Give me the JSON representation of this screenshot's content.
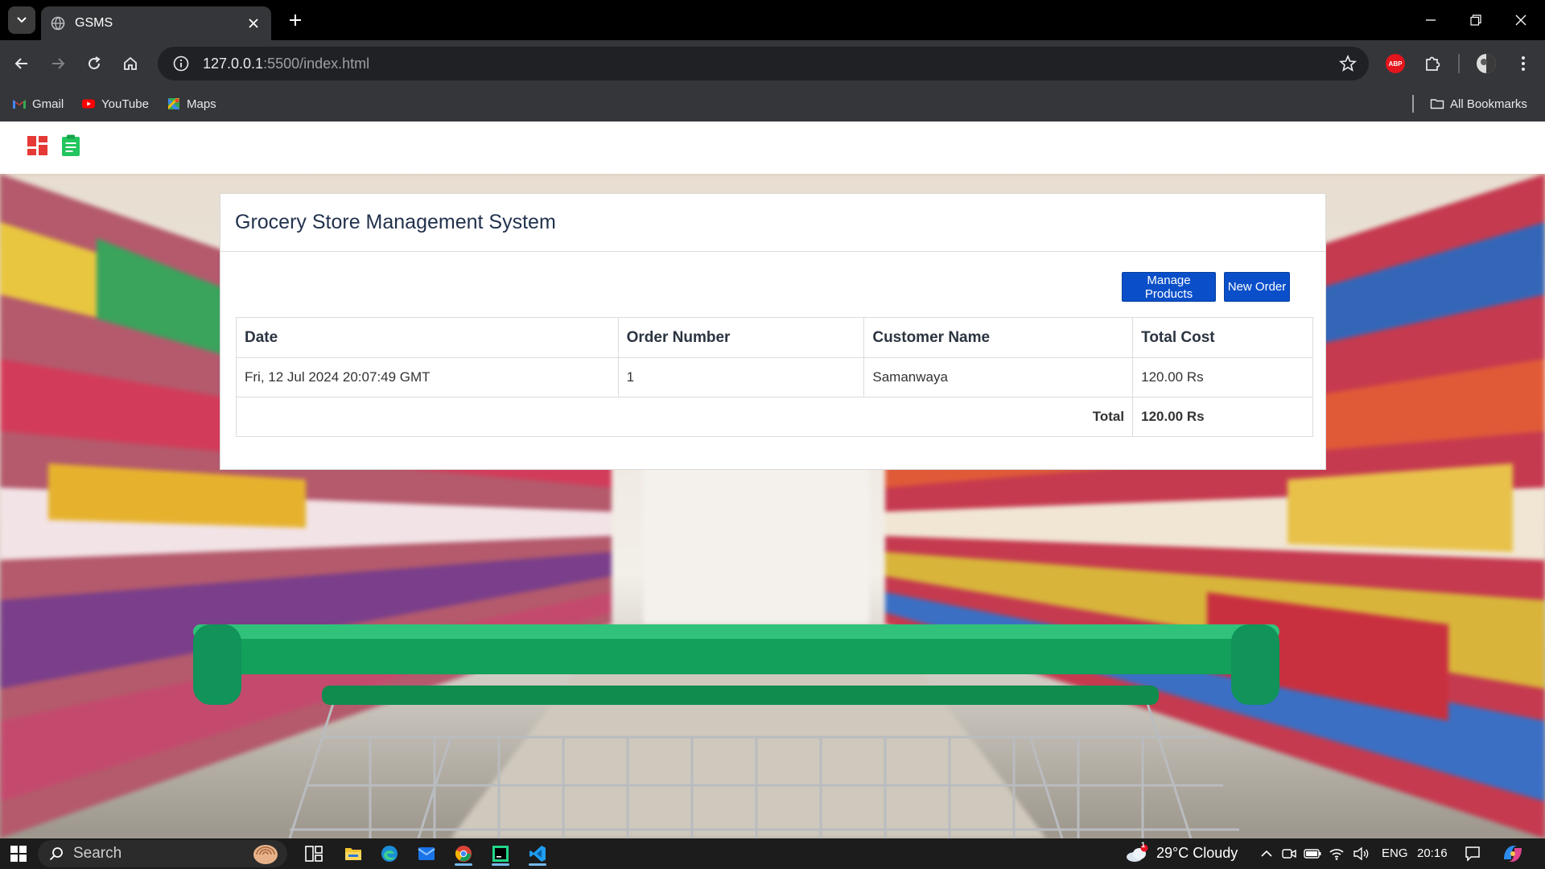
{
  "browser": {
    "tab_title": "GSMS",
    "url_host": "127.0.0.1",
    "url_path": ":5500/index.html",
    "bookmarks": [
      "Gmail",
      "YouTube",
      "Maps"
    ],
    "all_bookmarks": "All Bookmarks",
    "extension_badge": "ABP"
  },
  "navbar": {
    "icons": [
      "dashboard-icon",
      "clipboard-icon"
    ]
  },
  "panel": {
    "title": "Grocery Store Management System",
    "buttons": {
      "manage_products": "Manage Products",
      "new_order": "New Order"
    },
    "table": {
      "headers": [
        "Date",
        "Order Number",
        "Customer Name",
        "Total Cost"
      ],
      "rows": [
        {
          "date": "Fri, 12 Jul 2024 20:07:49 GMT",
          "order_number": "1",
          "customer_name": "Samanwaya",
          "total_cost": "120.00 Rs"
        }
      ],
      "total_label": "Total",
      "total_value": "120.00 Rs"
    }
  },
  "taskbar": {
    "search_placeholder": "Search",
    "weather": "29°C  Cloudy",
    "weather_badge": "1",
    "language": "ENG",
    "time": "20:16"
  },
  "colors": {
    "button_blue": "#0a4fc9",
    "cart_green": "#13a05a",
    "dashboard_icon": "#e53935",
    "clipboard_icon": "#22c55e"
  }
}
